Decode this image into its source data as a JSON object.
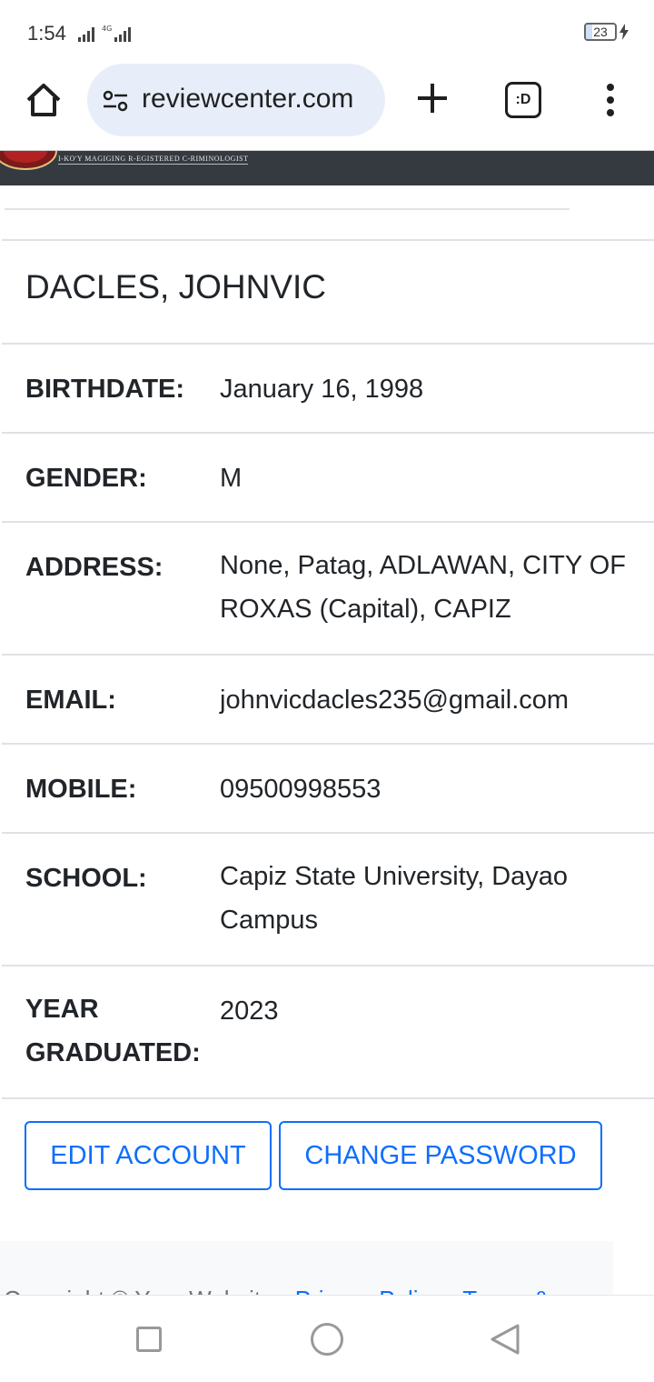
{
  "status_bar": {
    "time": "1:54",
    "network_label": "4G",
    "battery_level": "23",
    "battery_fraction": 0.23
  },
  "browser": {
    "url": "reviewcenter.com",
    "tab_switcher_label": ":D",
    "icons": [
      "home-icon",
      "site-settings-icon",
      "new-tab-icon",
      "tab-switcher-icon",
      "more-menu-icon"
    ]
  },
  "site_header": {
    "tagline": "I-KO'Y MAGIGING R-EGISTERED C-RIMINOLOGIST",
    "background_color": "#343a40"
  },
  "profile": {
    "name": "DACLES, JOHNVIC",
    "fields": [
      {
        "label": "BIRTHDATE:",
        "value": "January 16, 1998"
      },
      {
        "label": "GENDER:",
        "value": "M"
      },
      {
        "label": "ADDRESS:",
        "value": "None, Patag, ADLAWAN, CITY OF ROXAS (Capital), CAPIZ"
      },
      {
        "label": "EMAIL:",
        "value": "johnvicdacles235@gmail.com"
      },
      {
        "label": "MOBILE:",
        "value": "09500998553"
      },
      {
        "label": "SCHOOL:",
        "value": "Capiz State University, Dayao Campus"
      },
      {
        "label": "YEAR GRADUATED:",
        "value": "2023"
      }
    ]
  },
  "actions": {
    "edit_account": "EDIT ACCOUNT",
    "change_password": "CHANGE PASSWORD",
    "accent_color": "#0d6efd"
  },
  "footer": {
    "copyright": "Copyright © Your Website",
    "privacy_link": "Privacy Policy",
    "terms_link": "Terms &"
  },
  "nav_bar": {
    "icons": [
      "recents-icon",
      "home-nav-icon",
      "back-icon"
    ]
  }
}
